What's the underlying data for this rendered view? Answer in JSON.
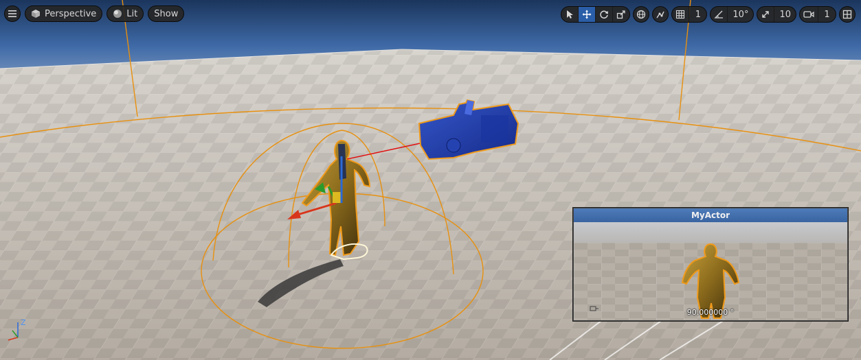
{
  "toolbar": {
    "menu_icon": "hamburger-icon",
    "perspective": {
      "label": "Perspective",
      "icon": "cube-icon"
    },
    "lit": {
      "label": "Lit",
      "icon": "sphere-icon"
    },
    "show": {
      "label": "Show"
    },
    "transform_tools": [
      "select-arrow-icon",
      "move-icon",
      "rotate-icon",
      "scale-icon"
    ],
    "active_tool": "move-icon",
    "coordinate_space_icon": "globe-icon",
    "surface_snap_icon": "surface-snap-icon",
    "grid_snap": {
      "icon": "grid-icon",
      "value": "1"
    },
    "rotation_snap": {
      "icon": "angle-icon",
      "value": "10°"
    },
    "scale_snap": {
      "icon": "scale-snap-icon",
      "value": "10"
    },
    "camera_speed": {
      "icon": "camera-icon",
      "value": "1"
    },
    "layout_icon": "viewport-layout-icon"
  },
  "pip": {
    "title": "MyActor",
    "readout": "90.000000 °",
    "cursor_icon": "pointer-cursor-icon"
  },
  "axis_gizmo": {
    "z": "Z"
  },
  "colors": {
    "accent_blue": "#2a5ea8",
    "selection_orange": "#e8900e",
    "sky_top": "#1f3f6e",
    "floor": "#bdb6ac"
  }
}
